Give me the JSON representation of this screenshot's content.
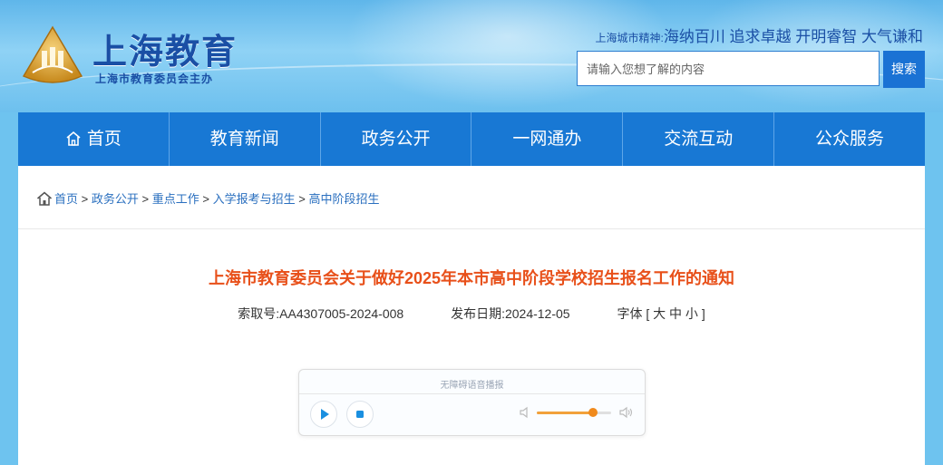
{
  "header": {
    "site_title": "上海教育",
    "site_subtitle": "上海市教育委员会主办",
    "slogan_label": "上海城市精神:",
    "slogan_text": "海纳百川 追求卓越 开明睿智 大气谦和",
    "search_placeholder": "请输入您想了解的内容",
    "search_button": "搜索"
  },
  "nav": [
    "首页",
    "教育新闻",
    "政务公开",
    "一网通办",
    "交流互动",
    "公众服务"
  ],
  "breadcrumb": [
    "首页",
    "政务公开",
    "重点工作",
    "入学报考与招生",
    "高中阶段招生"
  ],
  "article": {
    "title": "上海市教育委员会关于做好2025年本市高中阶段学校招生报名工作的通知",
    "index_no": "索取号:AA4307005-2024-008",
    "publish_date": "发布日期:2024-12-05",
    "font_size": "字体 [ 大 中 小 ]"
  },
  "player": {
    "title": "无障碍语音播报",
    "volume": 0.75
  },
  "colors": {
    "nav_bg": "#1878d4",
    "title_orange": "#e8501a",
    "brand_blue": "#1a4fa5"
  }
}
